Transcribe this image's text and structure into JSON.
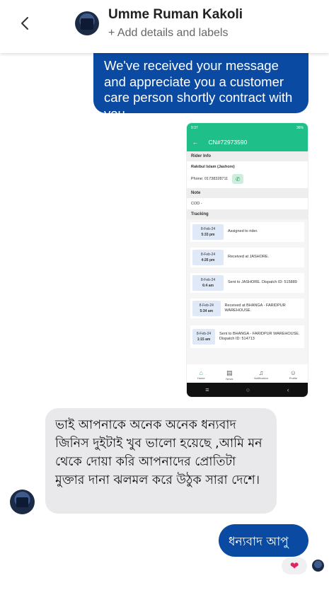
{
  "header": {
    "contact_name": "Umme Ruman Kakoli",
    "add_details": "+ Add details and labels"
  },
  "messages": {
    "top_sent": "We've received your message and appreciate you a customer care person shortly contract with you.",
    "received": "ভাই আপনাকে অনেক অনেক ধন্যবাদ জিনিস দুইটাই খুব ভালো হয়েছে ,আমি মন থেকে দোয়া করি আপনাদের প্রোতিটা মুক্তার দানা ঝলমল করে উঠুক সারা দেশে।",
    "sent_thanks": "ধন্যবাদ আপু",
    "reaction": "❤"
  },
  "screenshot": {
    "status_time": "9:37",
    "status_right": "36%",
    "title": "CN#72973590",
    "rider_info_label": "Rider Info",
    "rider_name": "Rakibul Islam (Jashore)",
    "phone": "Phone:  01738328711",
    "note_label": "Note",
    "note_value": "COD -",
    "tracking_label": "Tracking",
    "tracking": [
      {
        "date": "8-Feb-24",
        "time": "5:33 pm",
        "text": "Assigned to rider."
      },
      {
        "date": "8-Feb-24",
        "time": "4:26 pm",
        "text": "Received at JASHORE."
      },
      {
        "date": "8-Feb-24",
        "time": "6:4 am",
        "text": "Sent to JASHORE. Dispatch ID: 515889"
      },
      {
        "date": "8-Feb-24",
        "time": "5:34 am",
        "text": "Received at BHANGA - FARIDPUR WAREHOUSE."
      },
      {
        "date": "8-Feb-24",
        "time": "1:15 am",
        "text": "Sent to BHANGA - FARIDPUR WAREHOUSE. Dispatch ID: 514713"
      }
    ],
    "nav": [
      "Home",
      "News",
      "Notification",
      "Profile"
    ]
  }
}
